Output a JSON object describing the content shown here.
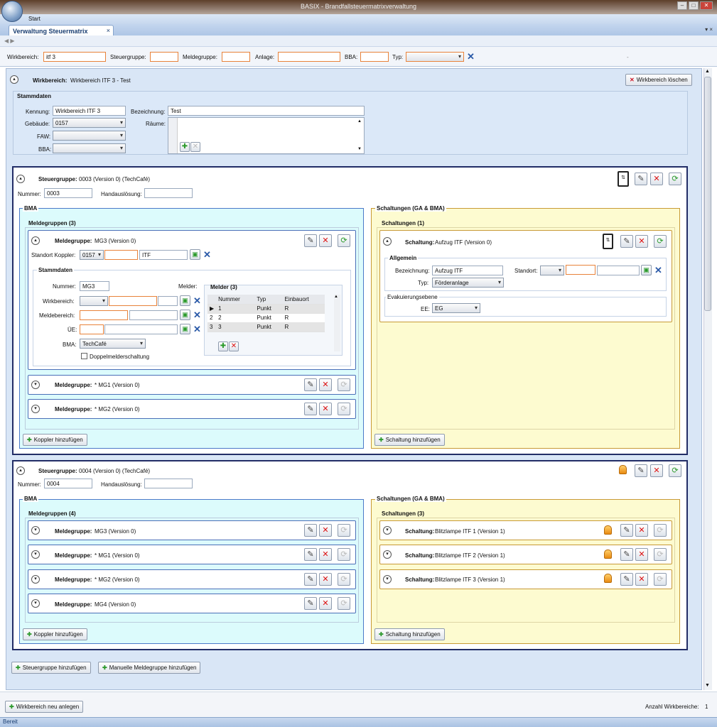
{
  "window": {
    "title": "BASIX - Brandfallsteuermatrixverwaltung",
    "menu_start": "Start"
  },
  "tab": {
    "label": "Verwaltung Steuermatrix",
    "close": "×",
    "arrows": "▾  ×"
  },
  "filter": {
    "wirkbereich_label": "Wirkbereich:",
    "wirkbereich_value": "itf 3",
    "steuergruppe_label": "Steuergruppe:",
    "meldegruppe_label": "Meldegruppe:",
    "anlage_label": "Anlage:",
    "bba_label": "BBA:",
    "typ_label": "Typ:",
    "note": "-"
  },
  "wirkbereich": {
    "header_label": "Wirkbereich:",
    "header_value": "Wirkbereich ITF 3 - Test",
    "delete_button": "Wirkbereich löschen",
    "stammdaten_title": "Stammdaten",
    "kennung_label": "Kennung:",
    "kennung_value": "Wirkbereich ITF 3",
    "bezeichnung_label": "Bezeichnung:",
    "bezeichnung_value": "Test",
    "gebaeude_label": "Gebäude:",
    "gebaeude_value": "0157",
    "faw_label": "FAW:",
    "bba_label": "BBA:",
    "raeume_label": "Räume:"
  },
  "sg1": {
    "title_label": "Steuergruppe:",
    "title_value": "0003 (Version 0) (TechCafé)",
    "nummer_label": "Nummer:",
    "nummer_value": "0003",
    "hand_label": "Handauslösung:",
    "bma_title": "BMA",
    "meldegruppen_title": "Meldegruppen (3)",
    "mg_open": {
      "label": "Meldegruppe:",
      "value": "MG3 (Version 0)",
      "standort_label": "Standort Koppler:",
      "standort_value": "0157",
      "standort_text": "ITF",
      "stammdaten_title": "Stammdaten",
      "nummer_label": "Nummer:",
      "nummer_value": "MG3",
      "wirkbereich_label": "Wirkbereich:",
      "meldebereich_label": "Meldebereich:",
      "ue_label": "ÜE:",
      "bma_label": "BMA:",
      "bma_value": "TechCafé",
      "doppel_label": "Doppelmelderschaltung",
      "melder_label": "Melder:",
      "melder_title": "Melder (3)",
      "table_headers": [
        "Nummer",
        "Typ",
        "Einbauort"
      ],
      "table_rows": [
        [
          "1",
          "Punkt",
          "R"
        ],
        [
          "2",
          "Punkt",
          "R"
        ],
        [
          "3",
          "Punkt",
          "R"
        ]
      ],
      "row_markers": [
        "▶",
        "2",
        "3"
      ]
    },
    "mg_closed": [
      {
        "label": "Meldegruppe:",
        "value": "* MG1 (Version 0)"
      },
      {
        "label": "Meldegruppe:",
        "value": "* MG2 (Version 0)"
      }
    ],
    "koppler_button": "Koppler hinzufügen",
    "schaltungen_title": "Schaltungen (GA & BMA)",
    "schaltungen_sub": "Schaltungen (1)",
    "schaltung": {
      "label": "Schaltung:",
      "value": "Aufzug ITF (Version 0)",
      "allgemein": "Allgemein",
      "bezeichnung_label": "Bezeichnung:",
      "bezeichnung_value": "Aufzug ITF",
      "standort_label": "Standort:",
      "typ_label": "Typ:",
      "typ_value": "Förderanlage",
      "evak_title": "Evakuierungsebene",
      "ee_label": "EE:",
      "ee_value": "EG"
    },
    "schaltung_button": "Schaltung hinzufügen"
  },
  "sg2": {
    "title_label": "Steuergruppe:",
    "title_value": "0004 (Version 0) (TechCafé)",
    "nummer_label": "Nummer:",
    "nummer_value": "0004",
    "hand_label": "Handauslösung:",
    "bma_title": "BMA",
    "meldegruppen_title": "Meldegruppen (4)",
    "mgs": [
      {
        "label": "Meldegruppe:",
        "value": "MG3 (Version 0)"
      },
      {
        "label": "Meldegruppe:",
        "value": "* MG1 (Version 0)"
      },
      {
        "label": "Meldegruppe:",
        "value": "* MG2 (Version 0)"
      },
      {
        "label": "Meldegruppe:",
        "value": "MG4 (Version 0)"
      }
    ],
    "koppler_button": "Koppler hinzufügen",
    "schaltungen_title": "Schaltungen (GA & BMA)",
    "schaltungen_sub": "Schaltungen (3)",
    "schaltungen": [
      {
        "label": "Schaltung:",
        "value": "Blitzlampe ITF 1 (Version 1)"
      },
      {
        "label": "Schaltung:",
        "value": "Blitzlampe ITF 2 (Version 1)"
      },
      {
        "label": "Schaltung:",
        "value": "Blitzlampe ITF 3 (Version 1)"
      }
    ],
    "schaltung_button": "Schaltung hinzufügen"
  },
  "actions": {
    "steuergruppe_add": "Steuergruppe hinzufügen",
    "manuelle_add": "Manuelle Meldegruppe hinzufügen"
  },
  "bottom": {
    "neu_button": "Wirkbereich neu anlegen",
    "anzahl_label": "Anzahl Wirkbereiche:",
    "anzahl_value": "1"
  },
  "status": {
    "text": "Bereit"
  },
  "icons": {
    "collapse": "chevron-up-icon",
    "expand": "chevron-down-icon",
    "edit": "pencil-icon",
    "delete": "delete-x-icon",
    "refresh": "refresh-icon",
    "add": "plus-icon",
    "lamp": "alarm-lamp-icon",
    "elevator": "elevator-icon"
  },
  "colors": {
    "accent_border": "#222d66",
    "bma_bg": "#dcfbfc",
    "schaltung_bg": "#fdfbd0",
    "required_border": "#e8823a",
    "panel_bg": "#d9e6f6"
  }
}
